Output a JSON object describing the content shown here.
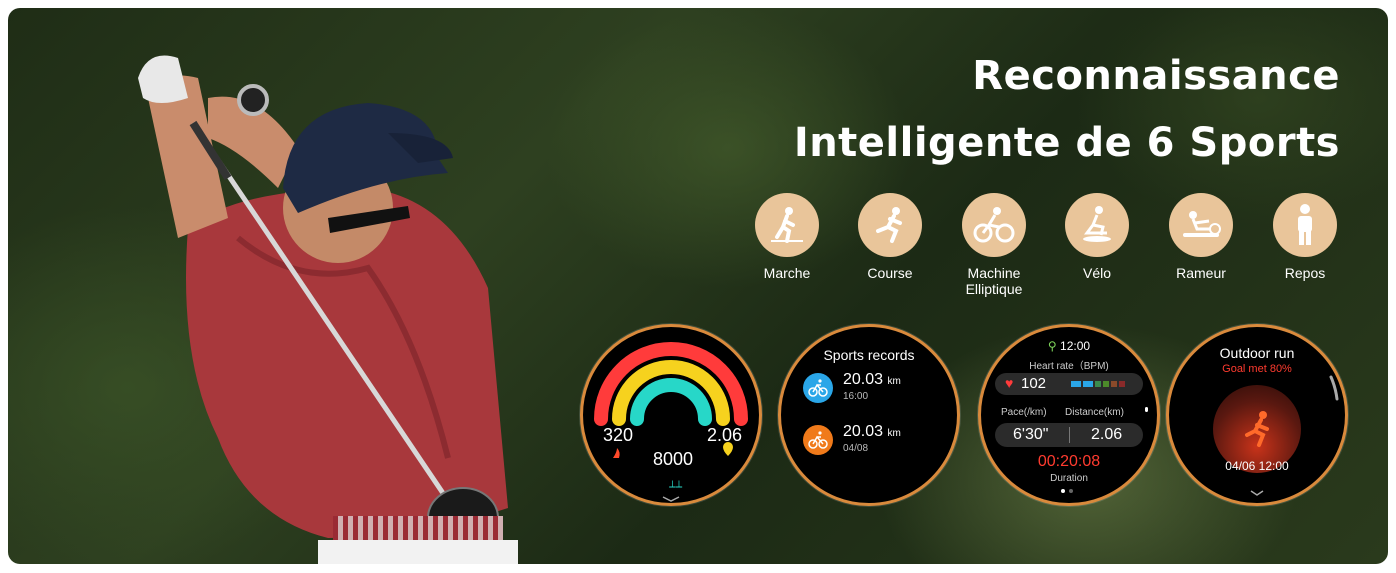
{
  "headline": {
    "line1": "Reconnaissance",
    "line2": "Intelligente de 6 Sports"
  },
  "sports": [
    {
      "label": "Marche",
      "icon": "walking-icon"
    },
    {
      "label": "Course",
      "icon": "running-icon"
    },
    {
      "label": "Machine Elliptique",
      "icon": "elliptical-icon"
    },
    {
      "label": "Vélo",
      "icon": "bike-icon"
    },
    {
      "label": "Rameur",
      "icon": "rower-icon"
    },
    {
      "label": "Repos",
      "icon": "standing-icon"
    }
  ],
  "watch1": {
    "calories": "320",
    "steps": "8000",
    "distance": "2.06"
  },
  "watch2": {
    "title": "Sports records",
    "records": [
      {
        "value": "20.03",
        "unit": "km",
        "sub": "16:00",
        "color": "#2aa6e8"
      },
      {
        "value": "20.03",
        "unit": "km",
        "sub": "04/08",
        "color": "#f07a1a"
      }
    ]
  },
  "watch3": {
    "time": "12:00",
    "heart_label": "Heart rate（BPM)",
    "heart_value": "102",
    "pace_label": "Pace(/km)",
    "distance_label": "Distance(km)",
    "pace_value": "6'30\"",
    "distance_value": "2.06",
    "duration_value": "00:20:08",
    "duration_label": "Duration"
  },
  "watch4": {
    "title": "Outdoor run",
    "goal": "Goal met 80%",
    "datetime": "04/06 12:00"
  },
  "colors": {
    "accent": "#e9c59a",
    "watch_ring": "#d98a3c",
    "goal_red": "#ff3b2f"
  }
}
